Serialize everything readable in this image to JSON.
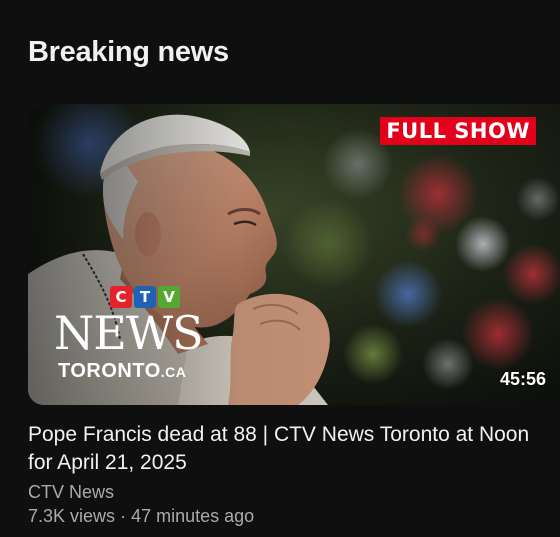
{
  "section": {
    "title": "Breaking news"
  },
  "video": {
    "badge": "FULL SHOW",
    "logo": {
      "ctv_letters": [
        "C",
        "T",
        "V"
      ],
      "news_word": "NEWS",
      "toronto_word": "TORONTO",
      "toronto_suffix": ".CA"
    },
    "duration": "45:56",
    "title": "Pope Francis dead at 88 | CTV News Toronto at Noon for April 21, 2025",
    "channel": "CTV News",
    "views": "7.3K views",
    "separator": "·",
    "published": "47 minutes ago"
  },
  "colors": {
    "background": "#0f0f0f",
    "badge_red": "#e3001b",
    "ctv_red": "#e4222b",
    "ctv_blue": "#1f62b4",
    "ctv_green": "#57a832",
    "secondary_text": "#aaaaaa"
  }
}
